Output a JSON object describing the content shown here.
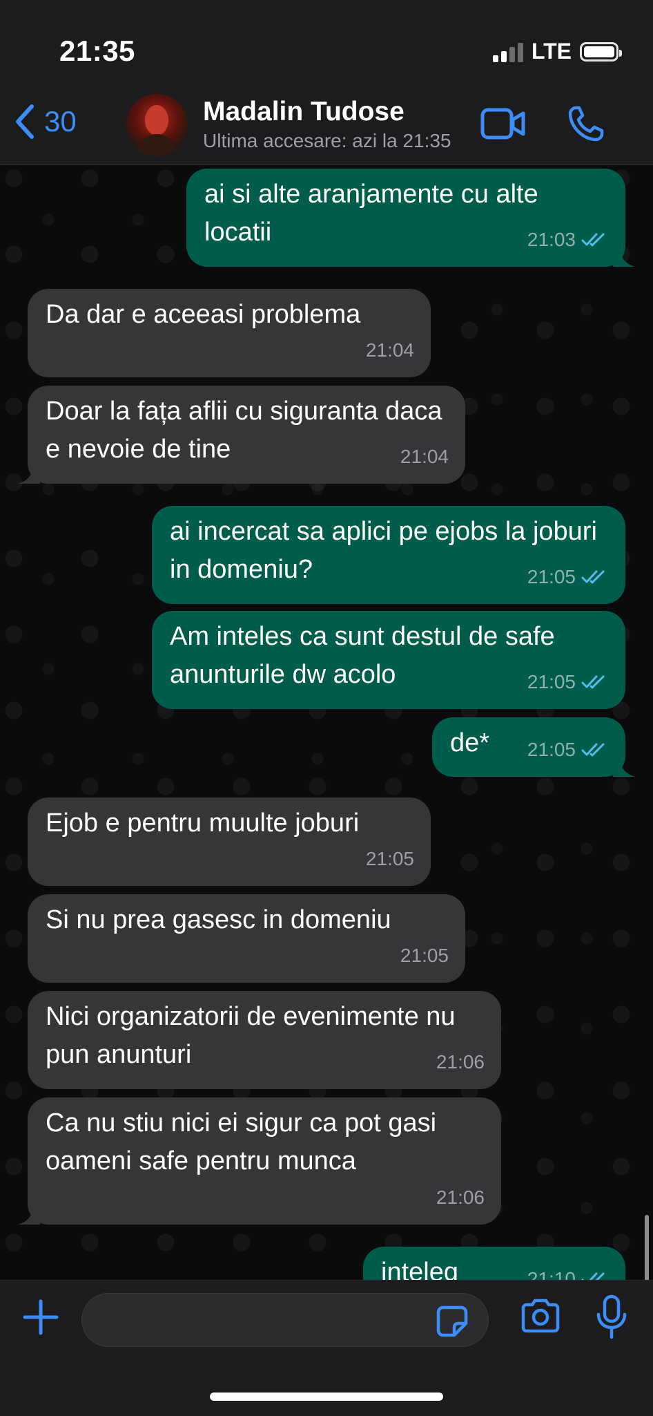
{
  "status_bar": {
    "time": "21:35",
    "network": "LTE"
  },
  "header": {
    "back_count": "30",
    "contact_name": "Madalin Tudose",
    "last_seen": "Ultima accesare: azi la 21:35",
    "icons": [
      "chevron-left-icon",
      "video-call-icon",
      "phone-icon"
    ]
  },
  "messages": [
    {
      "dir": "out",
      "text": "ai si alte aranjamente cu alte locatii",
      "time": "21:03",
      "read": true
    },
    {
      "dir": "in",
      "text": "Da dar e aceeasi problema",
      "time": "21:04"
    },
    {
      "dir": "in",
      "text": "Doar la fața aflii cu siguranta daca e nevoie de tine",
      "time": "21:04"
    },
    {
      "dir": "out",
      "text": "ai incercat sa aplici pe ejobs la joburi in domeniu?",
      "time": "21:05",
      "read": true
    },
    {
      "dir": "out",
      "text": "Am inteles ca sunt destul de safe anunturile dw acolo",
      "time": "21:05",
      "read": true
    },
    {
      "dir": "out",
      "text": "de*",
      "time": "21:05",
      "read": true
    },
    {
      "dir": "in",
      "text": "Ejob e pentru muulte joburi",
      "time": "21:05"
    },
    {
      "dir": "in",
      "text": "Si nu prea gasesc in domeniu",
      "time": "21:05"
    },
    {
      "dir": "in",
      "text": "Nici organizatorii de evenimente nu  pun anunturi",
      "time": "21:06"
    },
    {
      "dir": "in",
      "text": "Ca nu stiu nici ei sigur ca pot gasi oameni safe pentru munca",
      "time": "21:06"
    },
    {
      "dir": "out",
      "text": "inteleg",
      "time": "21:10",
      "read": true
    }
  ],
  "composer": {
    "input_value": "",
    "icons": [
      "plus-icon",
      "sticker-icon",
      "camera-icon",
      "microphone-icon"
    ]
  },
  "colors": {
    "accent": "#3c8df8",
    "outgoing_bubble": "#005c4b",
    "incoming_bubble": "#363638",
    "read_ticks": "#53bdeb"
  }
}
